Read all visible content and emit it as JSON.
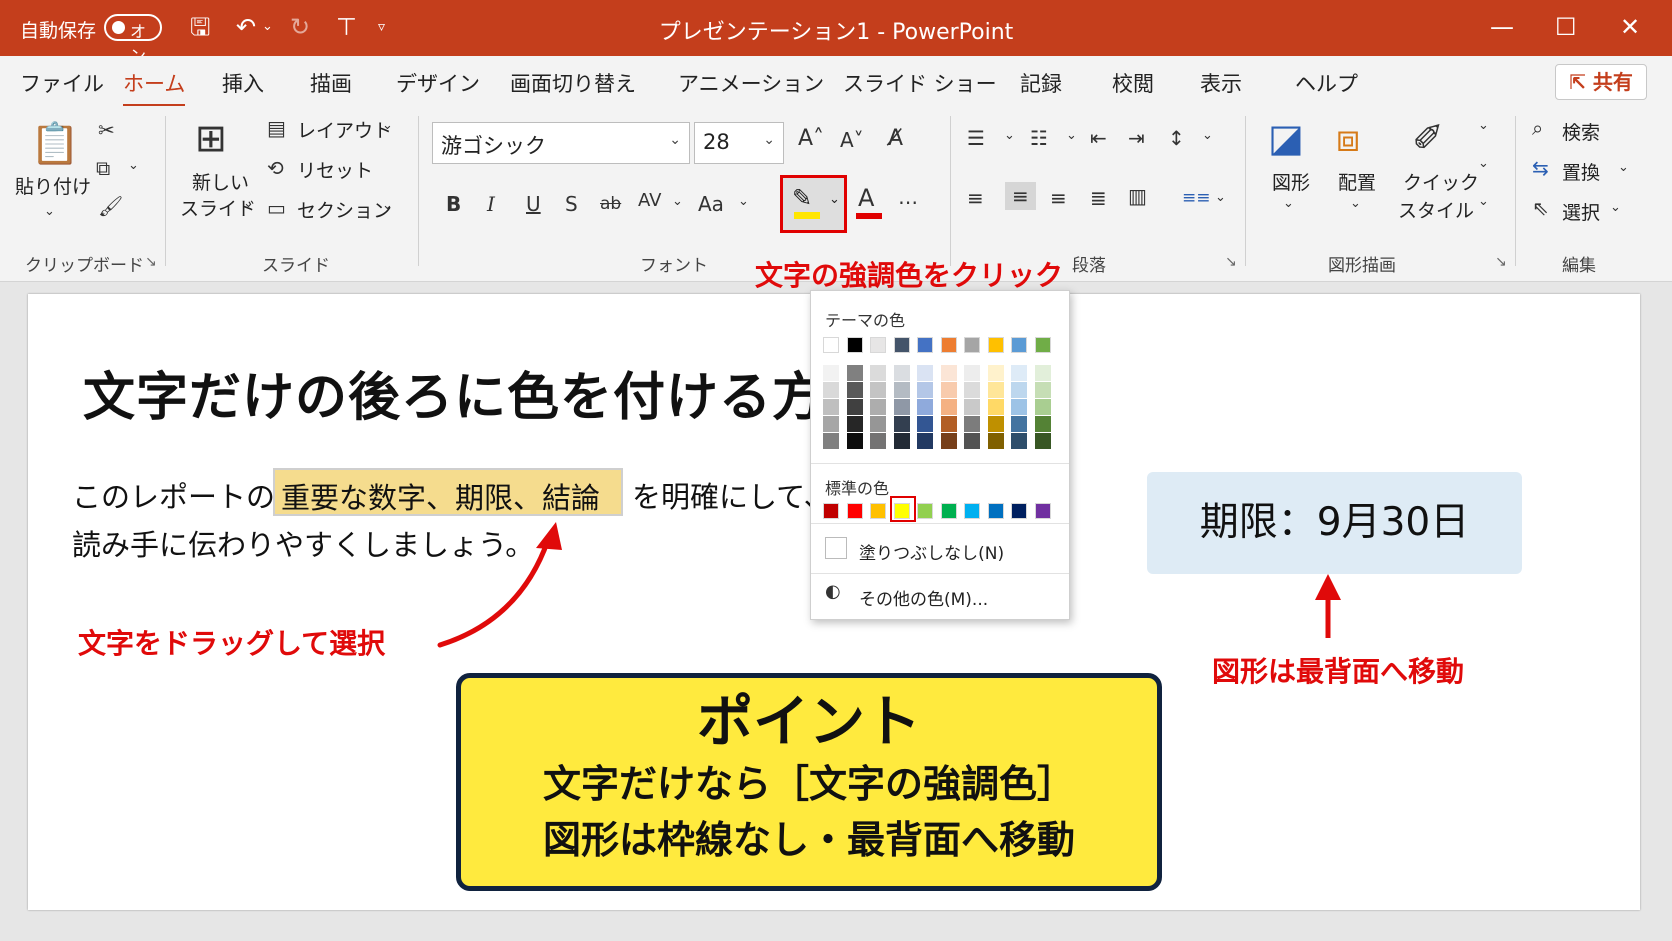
{
  "titlebar": {
    "autosave": "自動保存",
    "toggle": "オン",
    "title": "プレゼンテーション1  -  PowerPoint"
  },
  "menu": {
    "tabs": [
      "ファイル",
      "ホーム",
      "挿入",
      "描画",
      "デザイン",
      "画面切り替え",
      "アニメーション",
      "スライド ショー",
      "記録",
      "校閲",
      "表示",
      "ヘルプ"
    ],
    "active": "ホーム",
    "share": "共有"
  },
  "ribbon": {
    "clipboard": {
      "paste": "貼り付け",
      "group": "クリップボード"
    },
    "slides": {
      "new_slide_1": "新しい",
      "new_slide_2": "スライド",
      "layout": "レイアウト",
      "reset": "リセット",
      "section": "セクション",
      "group": "スライド"
    },
    "font": {
      "name": "游ゴシック",
      "size": "28",
      "bold": "B",
      "italic": "I",
      "underline": "U",
      "shadow": "S",
      "strike": "ab",
      "spacing": "AV",
      "case": "Aa",
      "group": "フォント"
    },
    "paragraph": {
      "group": "段落"
    },
    "drawing": {
      "shape": "図形",
      "arrange": "配置",
      "quick_1": "クイック",
      "quick_2": "スタイル",
      "group": "図形描画"
    },
    "editing": {
      "find": "検索",
      "replace": "置換",
      "select": "選択",
      "group": "編集"
    }
  },
  "callouts": {
    "highlight": "文字の強調色をクリック",
    "drag": "文字をドラッグして選択",
    "shape": "図形は最背面へ移動"
  },
  "slide": {
    "title": "文字だけの後ろに色を付ける方法",
    "body_pre": "このレポートの",
    "body_highlight": "重要な数字、期限、結論",
    "body_post": "を明確にして、",
    "body_line2": "読み手に伝わりやすくしましょう。",
    "deadline": "期限：9月30日",
    "point_title": "ポイント",
    "point_line1": "文字だけなら［文字の強調色］",
    "point_line2": "図形は枠線なし・最背面へ移動"
  },
  "palette": {
    "theme_title": "テーマの色",
    "standard_title": "標準の色",
    "no_fill": "塗りつぶしなし(N)",
    "more_colors": "その他の色(M)...",
    "theme_colors": [
      "#ffffff",
      "#000000",
      "#e7e6e6",
      "#44546a",
      "#4472c4",
      "#ed7d31",
      "#a5a5a5",
      "#ffc000",
      "#5b9bd5",
      "#70ad47"
    ],
    "standard_colors": [
      "#c00000",
      "#ff0000",
      "#ffc000",
      "#ffff00",
      "#92d050",
      "#00b050",
      "#00b0f0",
      "#0070c0",
      "#002060",
      "#7030a0"
    ],
    "selected": "#ffff00"
  },
  "colors": {
    "accent": "#c43e1c",
    "callout": "#e00a0a",
    "highlight": "#f5dc8e",
    "point_bg": "#ffea3e"
  }
}
